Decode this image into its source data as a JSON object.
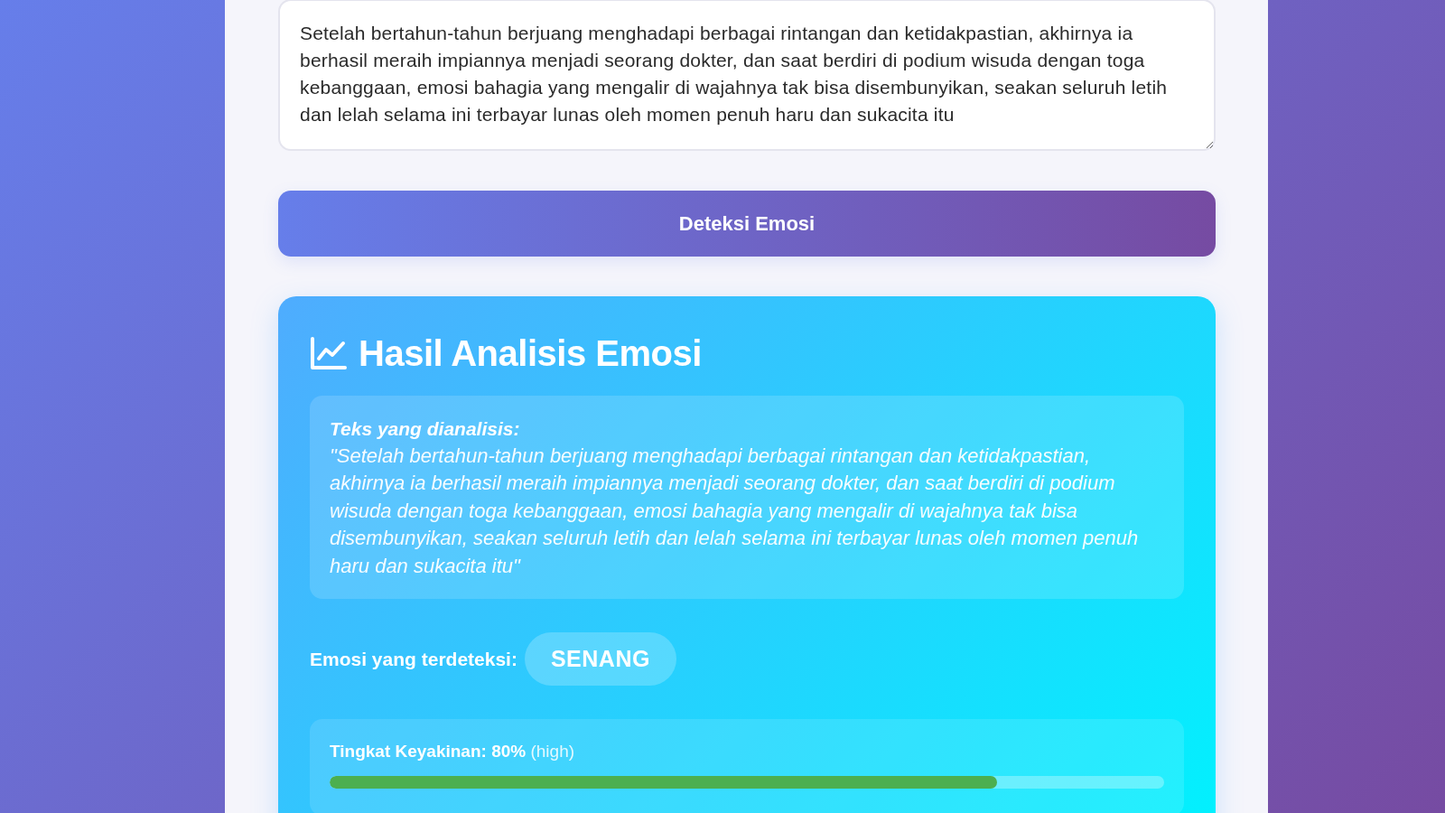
{
  "input": {
    "value": "Setelah bertahun-tahun berjuang menghadapi berbagai rintangan dan ketidakpastian, akhirnya ia berhasil meraih impiannya menjadi seorang dokter, dan saat berdiri di podium wisuda dengan toga kebanggaan, emosi bahagia yang mengalir di wajahnya tak bisa disembunyikan, seakan seluruh letih dan lelah selama ini terbayar lunas oleh momen penuh haru dan sukacita itu"
  },
  "submit_button": {
    "label": "Deteksi Emosi"
  },
  "result": {
    "title": "Hasil Analisis Emosi",
    "analyzed": {
      "label": "Teks yang dianalisis:",
      "text": "\"Setelah bertahun-tahun berjuang menghadapi berbagai rintangan dan ketidakpastian, akhirnya ia berhasil meraih impiannya menjadi seorang dokter, dan saat berdiri di podium wisuda dengan toga kebanggaan, emosi bahagia yang mengalir di wajahnya tak bisa disembunyikan, seakan seluruh letih dan lelah selama ini terbayar lunas oleh momen penuh haru dan sukacita itu\""
    },
    "emotion": {
      "label": "Emosi yang terdeteksi:",
      "value": "SENANG"
    },
    "confidence": {
      "text": "**Tingkat Keyakinan: 80%** (high)",
      "level": 0.8
    }
  }
}
